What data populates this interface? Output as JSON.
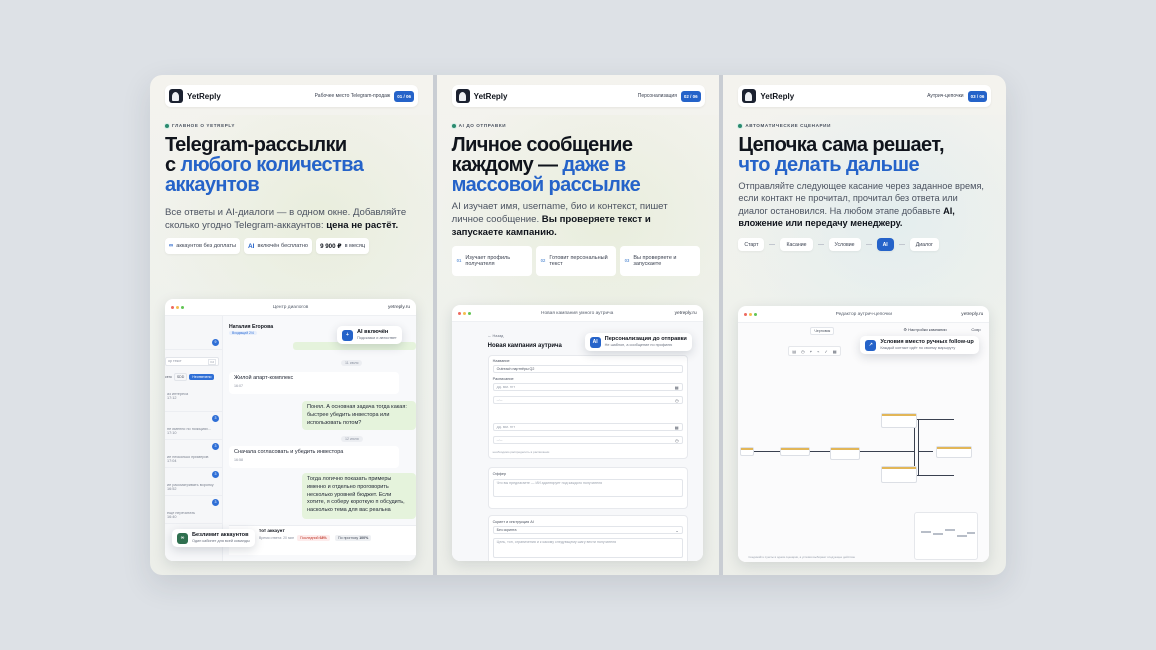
{
  "slides": [
    {
      "brand": "YetReply",
      "topbar_label": "Рабочее место Telegram-продаж",
      "page_indicator": "01 / 06",
      "eyebrow": "ГЛАВНОЕ О YETREPLY",
      "headline_1": "Telegram-рассылки",
      "headline_2a": "с ",
      "headline_2b": "любого количества",
      "headline_3": "аккаунтов",
      "sub_text": "Все ответы и AI-диалоги — в одном окне. Добавляйте сколько угодно Telegram-аккаунтов:",
      "sub_bold": "цена не растёт.",
      "chips": [
        {
          "icon": "∞",
          "text": "аккаунтов без доплаты"
        },
        {
          "icon": "AI",
          "text": "включён бесплатно"
        },
        {
          "value": "9 900 ₽",
          "text": "в месяц"
        }
      ],
      "app_title": "Центр диалогов",
      "app_url": "yetreply.ru",
      "sidebar": {
        "badges": [
          "9",
          "3",
          "3",
          "3",
          "3"
        ],
        "search_tail": "ор текст",
        "search_hint": "F2",
        "filter_1": "сего",
        "filter_2": "SDD",
        "filter_3": "Неотвечено",
        "previews": [
          {
            "text": "аз интереса",
            "time": "17:12"
          },
          {
            "text": "не именно по позициях...",
            "time": "17:10"
          },
          {
            "text": "ие несколько примеров",
            "time": "17:04"
          },
          {
            "text": "ие рассматривать воронку",
            "time": "16:52"
          },
          {
            "text": "еще перечитать",
            "time": "16:40"
          }
        ]
      },
      "chat": {
        "contact": "Наталия Егорова",
        "contact_tag": "Входящий 2/4",
        "date_1": "11 июля",
        "date_2": "12 июля",
        "messages": [
          {
            "dir": "in",
            "text": "Жилой апарт-комплекс",
            "time": "16:07"
          },
          {
            "dir": "out",
            "text": "Понял. А основная задача тогда какая: быстрее убедить инвестора или использовать потом?"
          },
          {
            "dir": "in",
            "text": "Сначала согласовать и убедить инвестора",
            "time": "16:58"
          },
          {
            "dir": "out",
            "text": "Тогда логично показать примеры именно и отдельно проговорить несколько уровней бюджет. Если хотите, я соберу короткую п обсудить, насколько тема для вас реальна"
          }
        ],
        "bottom_title": "тот аккаунт",
        "bottom_meta": "Время ответа: 20 мин",
        "score_1_label": "Последний",
        "score_1": "68%",
        "score_2_label": "По прогнозу",
        "score_2": "100%"
      },
      "float_ai": {
        "icon": "+",
        "title": "AI включён",
        "subtitle": "Подсказки и автоответ"
      },
      "float_unlimited": {
        "icon": "∞",
        "title": "Безлимит аккаунтов",
        "subtitle": "Один кабинет для всей команды"
      }
    },
    {
      "brand": "YetReply",
      "topbar_label": "Персонализация",
      "page_indicator": "02 / 06",
      "eyebrow": "AI ДО ОТПРАВКИ",
      "headline_1": "Личное сообщение",
      "headline_2a": "каждому — ",
      "headline_2b": "даже в",
      "headline_3": "массовой рассылке",
      "sub_text": "AI изучает имя, username, био и контекст, пишет личное сообщение.",
      "sub_bold": "Вы проверяете текст и запускаете кампанию.",
      "steps": [
        {
          "num": "01",
          "text": "Изучает профиль получателя"
        },
        {
          "num": "02",
          "text": "Готовит персональный текст"
        },
        {
          "num": "03",
          "text": "Вы проверяете и запускаете"
        }
      ],
      "app_title": "Новая кампания умного аутрича",
      "app_url": "yetreply.ru",
      "form": {
        "back": "← Назад",
        "title": "Новая кампания аутрича",
        "name_label": "Название",
        "name_value": "Outreach партнёры Q2",
        "schedule_label": "Расписание",
        "date_placeholder": "дд. мм. гггг",
        "time_placeholder": "--:--",
        "hint": "необходимо распределить в расписании",
        "offer_label": "Оффер",
        "offer_placeholder": "Что вы предлагаете — ИИ адаптирует под каждого получателя",
        "script_label": "Скрипт и инструкция AI",
        "script_value": "Без скрипта",
        "goal_placeholder": "Цель, тон, ограничения и к какому следующему шагу вести получателя"
      },
      "float_personal": {
        "icon": "AI",
        "title": "Персонализация до отправки",
        "subtitle": "Не шаблон, а сообщение по профилю"
      }
    },
    {
      "brand": "YetReply",
      "topbar_label": "Аутрич-цепочки",
      "page_indicator": "03 / 06",
      "eyebrow": "АВТОМАТИЧЕСКИЕ СЦЕНАРИИ",
      "headline_1": "Цепочка сама решает,",
      "headline_2b": "что делать дальше",
      "sub_text": "Отправляйте следующее касание через заданное время, если контакт не прочитал, прочитал без ответа или диалог остановился. На любом этапе добавьте",
      "sub_bold": "AI, вложение или передачу менеджеру.",
      "route": [
        "Старт",
        "Касание",
        "Условие",
        "AI",
        "Диалог"
      ],
      "app_title": "Редактор аутрич-цепочки",
      "app_url": "yetreply.ru",
      "editor": {
        "tab": "Черновик",
        "settings": "Настройки кампании",
        "save": "Сохр",
        "footer": "Соединяйте пункты в одном сценарии, а условия выбирают следующее действие"
      },
      "float_conditions": {
        "icon": "↗",
        "title": "Условия вместо ручных follow-up",
        "subtitle": "Каждый контакт идёт по своему маршруту"
      }
    }
  ],
  "colors": {
    "accent": "#2563c9",
    "dark": "#10141c",
    "muted": "#4c5361"
  }
}
